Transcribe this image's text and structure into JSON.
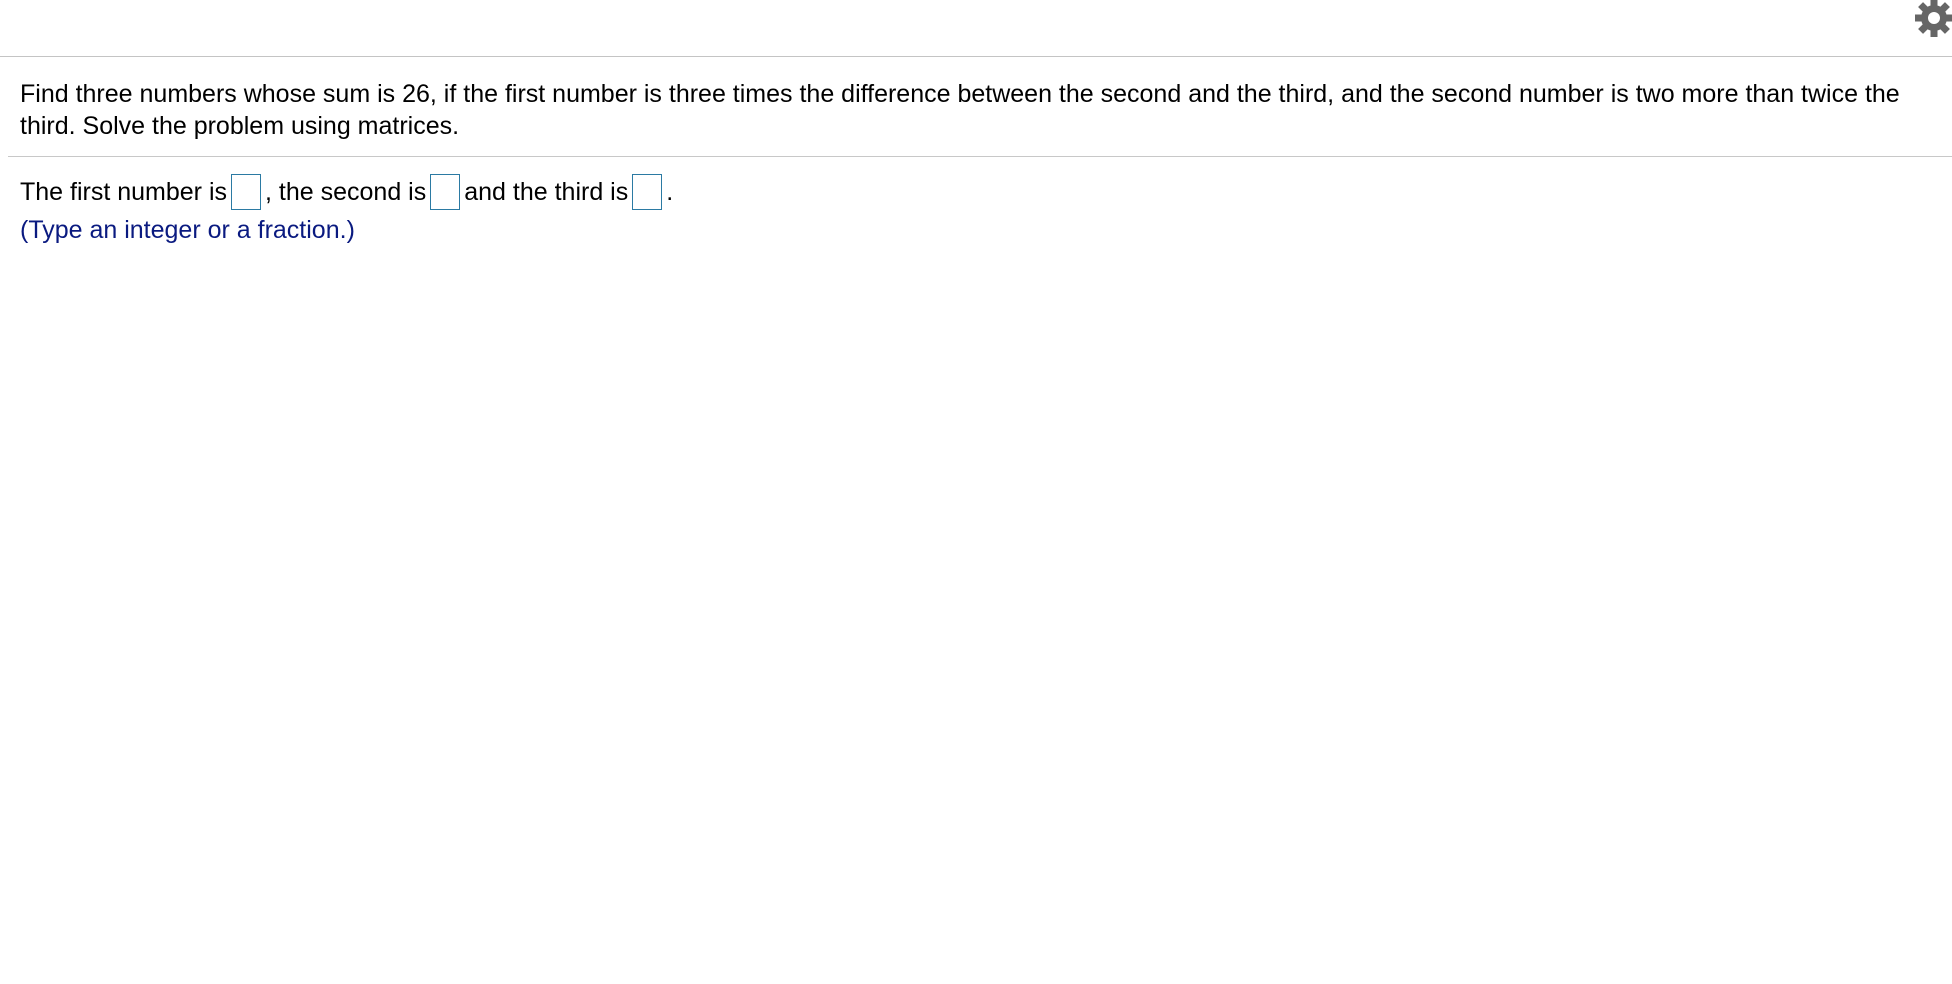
{
  "header": {
    "settings_icon": "gear-icon",
    "icon_color": "#666666"
  },
  "question": {
    "text": "Find three numbers whose sum is 26, if the first number is three times the difference between the second and the third, and the second number is two more than twice the third. Solve the problem using matrices."
  },
  "answer": {
    "prefix_first": "The first number is",
    "prefix_second": ", the second is",
    "prefix_third": "and the third is",
    "suffix": ".",
    "first_value": "",
    "second_value": "",
    "third_value": ""
  },
  "hint": {
    "text": "(Type an integer or a fraction.)",
    "color": "#0a1a80"
  },
  "colors": {
    "input_border": "#2b7aa3",
    "divider": "#c8c8c8"
  }
}
